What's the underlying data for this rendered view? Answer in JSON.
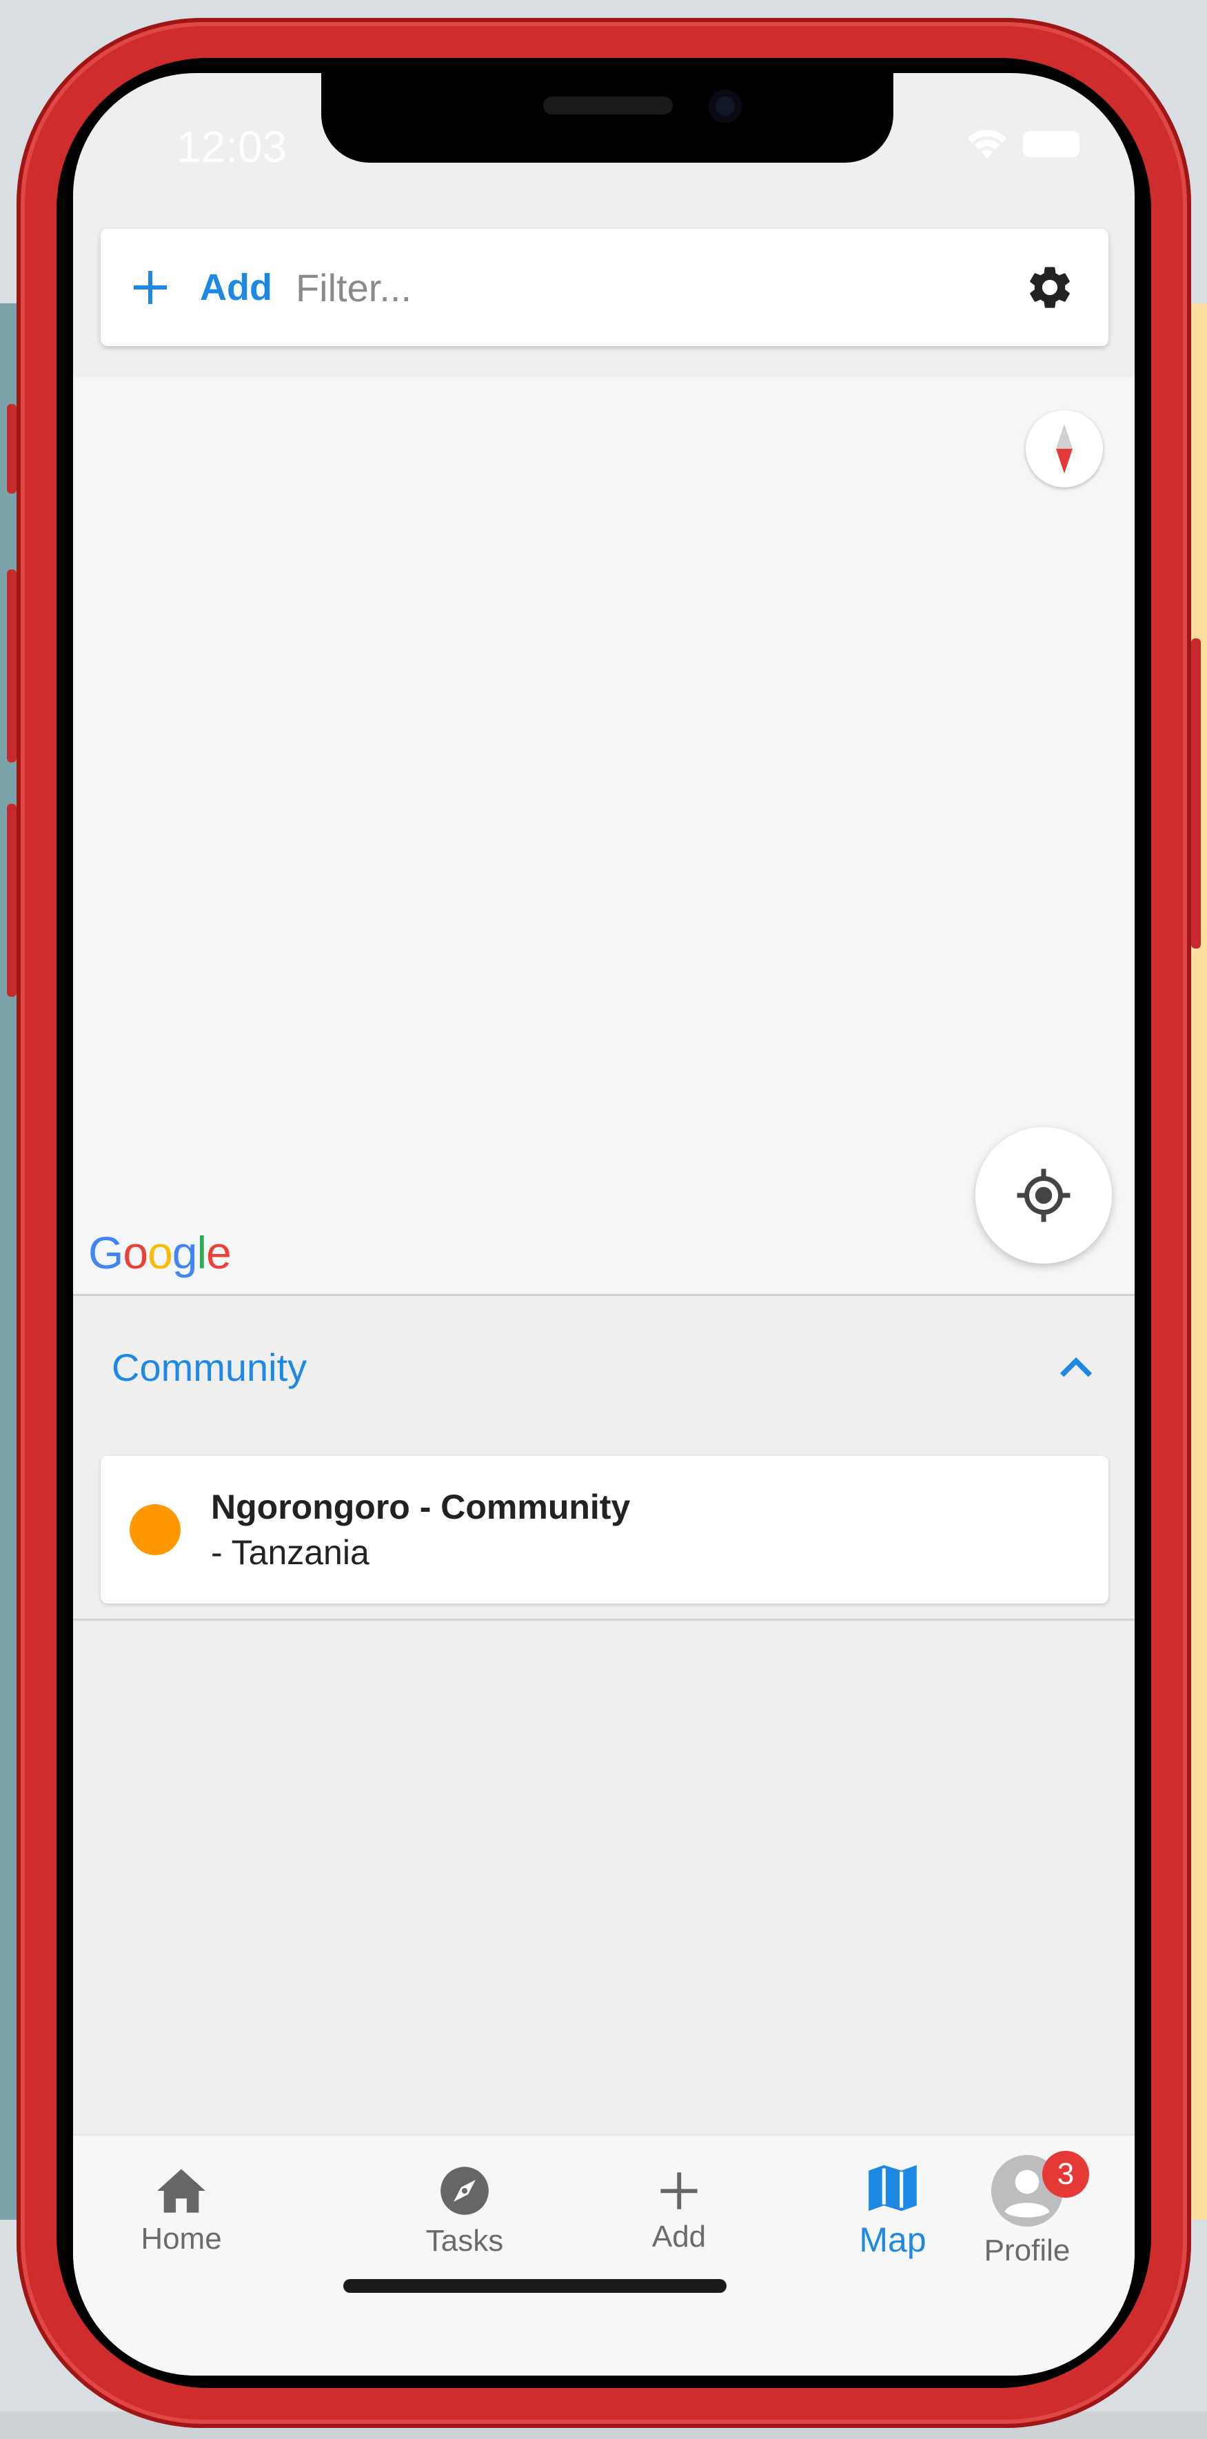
{
  "status_bar": {
    "time": "12:03"
  },
  "search_bar": {
    "add_label": "Add",
    "filter_placeholder": "Filter..."
  },
  "map": {
    "attribution": "Google"
  },
  "section": {
    "title": "Community",
    "items": [
      {
        "name": "Ngorongoro - Community",
        "country": "- Tanzania",
        "status_color": "#ff9800"
      }
    ]
  },
  "tabbar": {
    "tabs": [
      {
        "label": "Home",
        "icon": "home-icon"
      },
      {
        "label": "Tasks",
        "icon": "compass-icon"
      },
      {
        "label": "Add",
        "icon": "plus-icon"
      },
      {
        "label": "Map",
        "icon": "map-icon",
        "active": true
      },
      {
        "label": "Profile",
        "icon": "avatar-icon",
        "badge": "3"
      }
    ]
  },
  "colors": {
    "accent": "#1e88e5",
    "badge": "#e53935",
    "phone_frame": "#cf2d2d"
  }
}
